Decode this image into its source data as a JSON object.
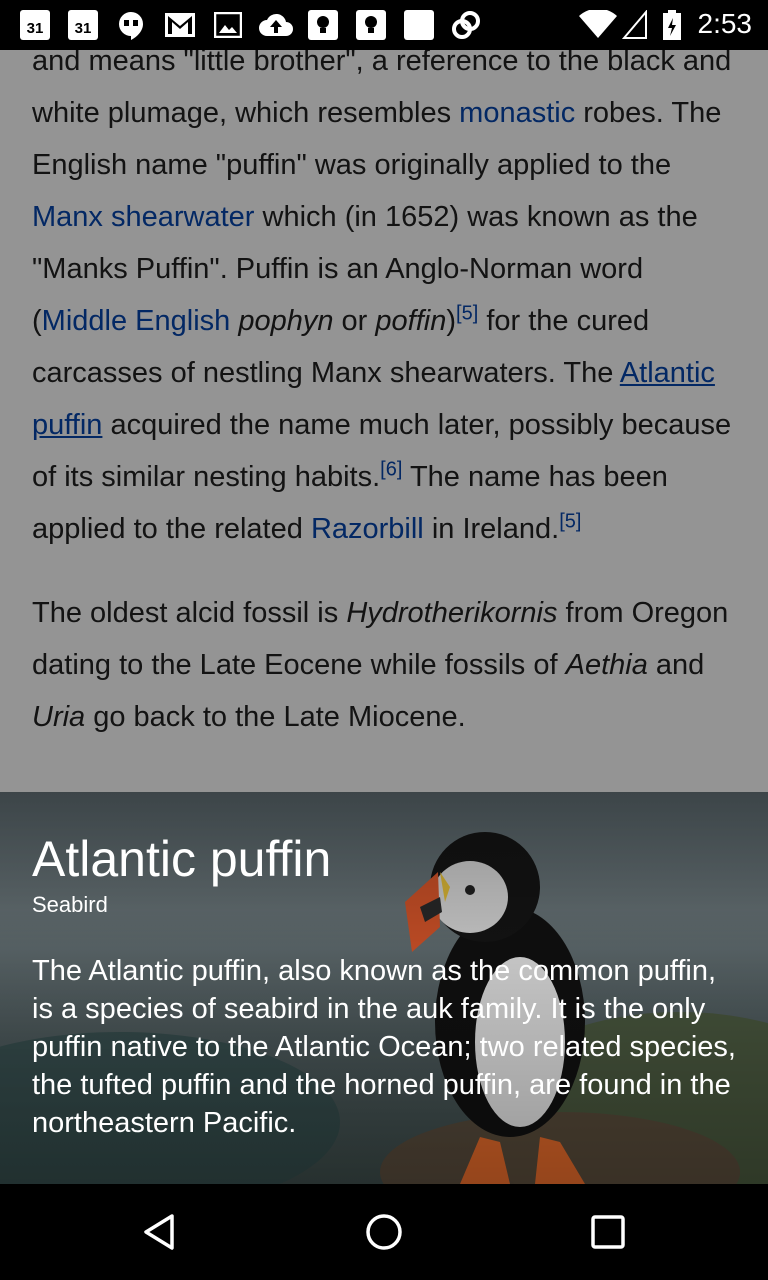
{
  "status_bar": {
    "time": "2:53",
    "calendar_1": "31",
    "calendar_2": "31",
    "icons": [
      "calendar-icon",
      "calendar-icon",
      "hangouts-icon",
      "gmail-icon",
      "image-icon",
      "cloud-upload-icon",
      "keep-icon",
      "keep-icon",
      "square-icon",
      "link-icon",
      "wifi-icon",
      "signal-icon",
      "battery-icon"
    ]
  },
  "article": {
    "p1": {
      "t1": "and means \"little brother\", a reference to the black and white plumage, which resembles ",
      "l_monastic": "monastic",
      "t2": " robes. The English name \"puffin\" was originally applied to the ",
      "l_manx": "Manx shearwater",
      "t3": " which (in 1652) was known as the \"Manks Puffin\". Puffin is an Anglo-Norman word (",
      "l_middle_english": "Middle English",
      "t4_space": " ",
      "i_pophyn": "pophyn",
      "t5": " or ",
      "i_poffin": "poffin",
      "t6": ")",
      "ref5a": "[5]",
      "t7": " for the cured carcasses of nestling Manx shearwaters. The ",
      "l_atlantic": "Atlantic puffin",
      "t8": " acquired the name much later, possibly because of its similar nesting habits.",
      "ref6": "[6]",
      "t9": " The name has been applied to the related ",
      "l_razorbill": "Razorbill",
      "t10": " in Ireland.",
      "ref5b": "[5]"
    },
    "p2": {
      "t1": "The oldest alcid fossil is ",
      "i_hydro": "Hydrotherikornis",
      "t2": " from Oregon dating to the Late Eocene while fossils of ",
      "i_aethia": "Aethia",
      "t3": " and ",
      "i_uria": "Uria",
      "t4": " go back to the Late Miocene."
    }
  },
  "preview": {
    "title": "Atlantic puffin",
    "subtitle": "Seabird",
    "extract": "The Atlantic puffin, also known as the common puffin, is a species of seabird in the auk family. It is the only puffin native to the Atlantic Ocean; two related species, the tufted puffin and the horned puffin, are found in the northeastern Pacific."
  },
  "nav_bar": {
    "icons": [
      "back-icon",
      "home-icon",
      "recents-icon"
    ]
  },
  "colors": {
    "link": "#0645ad",
    "text": "#222222",
    "overlay": "rgba(0,0,0,0.42)"
  }
}
